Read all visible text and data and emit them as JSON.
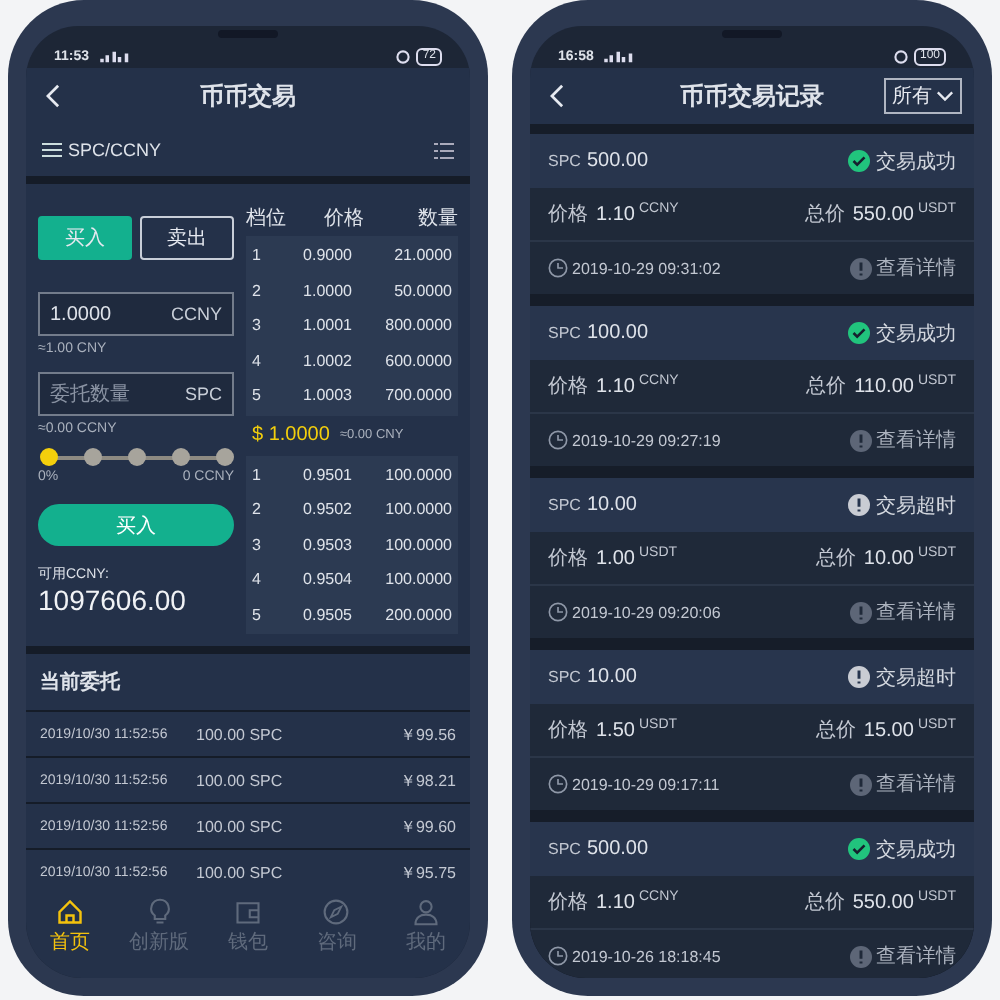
{
  "trade_screen": {
    "status_bar": {
      "time": "11:53",
      "battery": "72"
    },
    "title": "币币交易",
    "pair": "SPC/CCNY",
    "side_tabs": [
      {
        "label": "买入",
        "selected": true
      },
      {
        "label": "卖出",
        "selected": false
      }
    ],
    "price_field": {
      "value": "1.0000",
      "unit": "CCNY",
      "note": "≈1.00 CNY"
    },
    "amount_field": {
      "placeholder": "委托数量",
      "unit": "SPC",
      "note": "≈0.00 CCNY"
    },
    "slider": {
      "level": 0,
      "min_label": "0%",
      "max_label": "0 CCNY"
    },
    "submit_button": "买入",
    "available": {
      "label": "可用CCNY:",
      "value": "1097606.00"
    },
    "order_book": {
      "columns": [
        "档位",
        "价格",
        "数量"
      ],
      "asks": [
        {
          "rank": "1",
          "price": "0.9000",
          "amount": "21.0000"
        },
        {
          "rank": "2",
          "price": "1.0000",
          "amount": "50.0000"
        },
        {
          "rank": "3",
          "price": "1.0001",
          "amount": "800.0000"
        },
        {
          "rank": "4",
          "price": "1.0002",
          "amount": "600.0000"
        },
        {
          "rank": "5",
          "price": "1.0003",
          "amount": "700.0000"
        }
      ],
      "last_price": "$ 1.0000",
      "last_price_cny": "≈0.00 CNY",
      "bids": [
        {
          "rank": "1",
          "price": "0.9501",
          "amount": "100.0000"
        },
        {
          "rank": "2",
          "price": "0.9502",
          "amount": "100.0000"
        },
        {
          "rank": "3",
          "price": "0.9503",
          "amount": "100.0000"
        },
        {
          "rank": "4",
          "price": "0.9504",
          "amount": "100.0000"
        },
        {
          "rank": "5",
          "price": "0.9505",
          "amount": "200.0000"
        }
      ]
    },
    "orders_title": "当前委托",
    "orders": [
      {
        "time": "2019/10/30 11:52:56",
        "amount": "100.00 SPC",
        "price": "￥99.56"
      },
      {
        "time": "2019/10/30 11:52:56",
        "amount": "100.00 SPC",
        "price": "￥98.21"
      },
      {
        "time": "2019/10/30 11:52:56",
        "amount": "100.00 SPC",
        "price": "￥99.60"
      },
      {
        "time": "2019/10/30 11:52:56",
        "amount": "100.00 SPC",
        "price": "￥95.75"
      }
    ],
    "nav": [
      {
        "kind": "home",
        "label": "首页",
        "selected": true
      },
      {
        "kind": "bulb",
        "label": "创新版",
        "selected": false
      },
      {
        "kind": "wallet",
        "label": "钱包",
        "selected": false
      },
      {
        "kind": "compass",
        "label": "咨询",
        "selected": false
      },
      {
        "kind": "person",
        "label": "我的",
        "selected": false
      }
    ]
  },
  "records_screen": {
    "status_bar": {
      "time": "16:58",
      "battery": "100"
    },
    "title": "币币交易记录",
    "filter": "所有",
    "records": [
      {
        "coin": "SPC",
        "amount": "500.00",
        "status": {
          "kind": "success",
          "label": "交易成功"
        },
        "price_label": "价格",
        "price": "1.10",
        "price_unit": "CCNY",
        "total_label": "总价",
        "total": "550.00",
        "total_unit": "USDT",
        "time": "2019-10-29 09:31:02",
        "details": "查看详情"
      },
      {
        "coin": "SPC",
        "amount": "100.00",
        "status": {
          "kind": "success",
          "label": "交易成功"
        },
        "price_label": "价格",
        "price": "1.10",
        "price_unit": "CCNY",
        "total_label": "总价",
        "total": "110.00",
        "total_unit": "USDT",
        "time": "2019-10-29 09:27:19",
        "details": "查看详情"
      },
      {
        "coin": "SPC",
        "amount": "10.00",
        "status": {
          "kind": "timeout",
          "label": "交易超时"
        },
        "price_label": "价格",
        "price": "1.00",
        "price_unit": "USDT",
        "total_label": "总价",
        "total": "10.00",
        "total_unit": "USDT",
        "time": "2019-10-29 09:20:06",
        "details": "查看详情"
      },
      {
        "coin": "SPC",
        "amount": "10.00",
        "status": {
          "kind": "timeout",
          "label": "交易超时"
        },
        "price_label": "价格",
        "price": "1.50",
        "price_unit": "USDT",
        "total_label": "总价",
        "total": "15.00",
        "total_unit": "USDT",
        "time": "2019-10-29 09:17:11",
        "details": "查看详情"
      },
      {
        "coin": "SPC",
        "amount": "500.00",
        "status": {
          "kind": "success",
          "label": "交易成功"
        },
        "price_label": "价格",
        "price": "1.10",
        "price_unit": "CCNY",
        "total_label": "总价",
        "total": "550.00",
        "total_unit": "USDT",
        "time": "2019-10-26 18:18:45",
        "details": "查看详情"
      }
    ]
  }
}
